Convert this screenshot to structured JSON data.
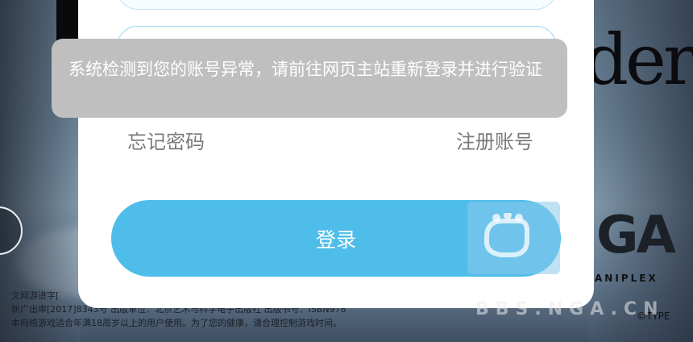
{
  "toast": {
    "message": "系统检测到您的账号异常，请前往网页主站重新登录并进行验证"
  },
  "links": {
    "forgot_password": "忘记密码",
    "register": "注册账号"
  },
  "login_button": "登录",
  "background": {
    "title_art": "der",
    "nga_mark": "GA",
    "aniplex": "ANIPLEX",
    "type_mark": "©TYPE",
    "watermark": "BBS.NGA.CN",
    "notice_lines": [
      "文网游进字[",
      "新广出审[2017]8343号  出版单位：北京艺术与科学电子出版社  出版书号：ISBN978",
      "本网络游戏适合年满18周岁以上的用户使用。为了您的健康，请合理控制游戏时间。"
    ]
  },
  "colors": {
    "login_button": "#4fbde9",
    "toast_bg": "#bfbfbf",
    "link_text": "#7a7a7a"
  }
}
